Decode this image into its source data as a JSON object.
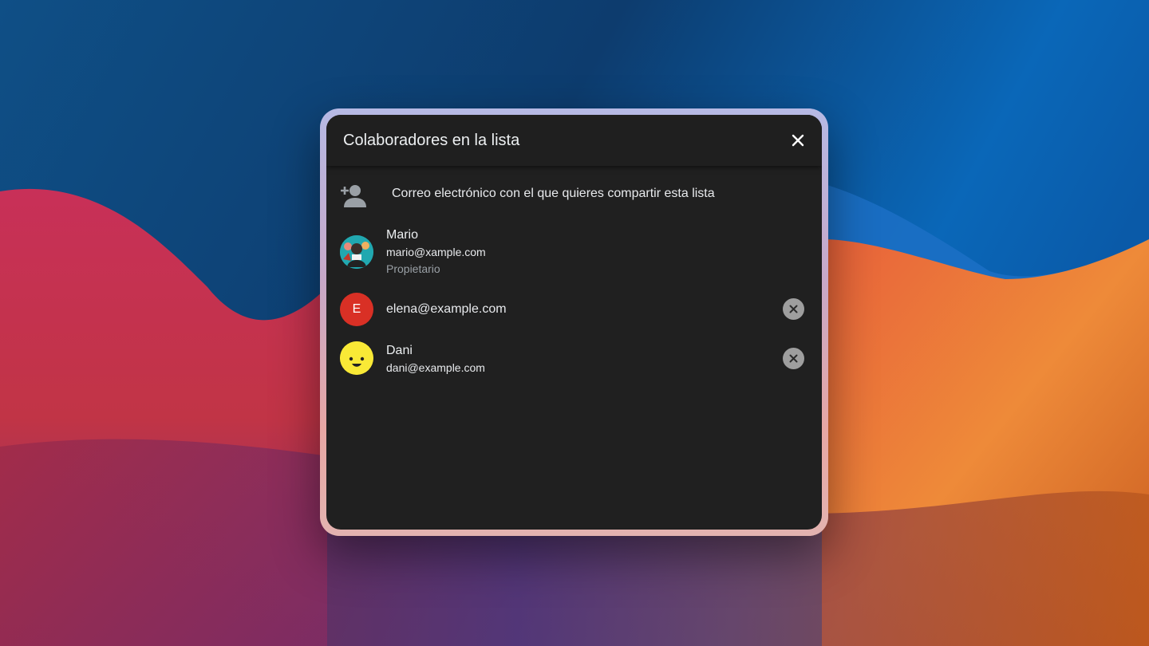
{
  "dialog": {
    "title": "Colaboradores en la lista",
    "close_icon": "close-icon"
  },
  "share": {
    "icon": "person-add-icon",
    "placeholder": "Correo electrónico con el que quieres compartir esta lista"
  },
  "collaborators": [
    {
      "name": "Mario",
      "email": "mario@xample.com",
      "role": "Propietario",
      "avatar": "photo-avatar",
      "removable": false
    },
    {
      "name": "",
      "email": "elena@example.com",
      "avatar_letter": "E",
      "avatar_color": "#d93025",
      "removable": true
    },
    {
      "name": "Dani",
      "email": "dani@example.com",
      "avatar": "smiley-avatar",
      "avatar_color": "#f9e936",
      "removable": true
    }
  ],
  "colors": {
    "dialog_bg": "#202020",
    "remove_button": "#9e9e9e"
  }
}
